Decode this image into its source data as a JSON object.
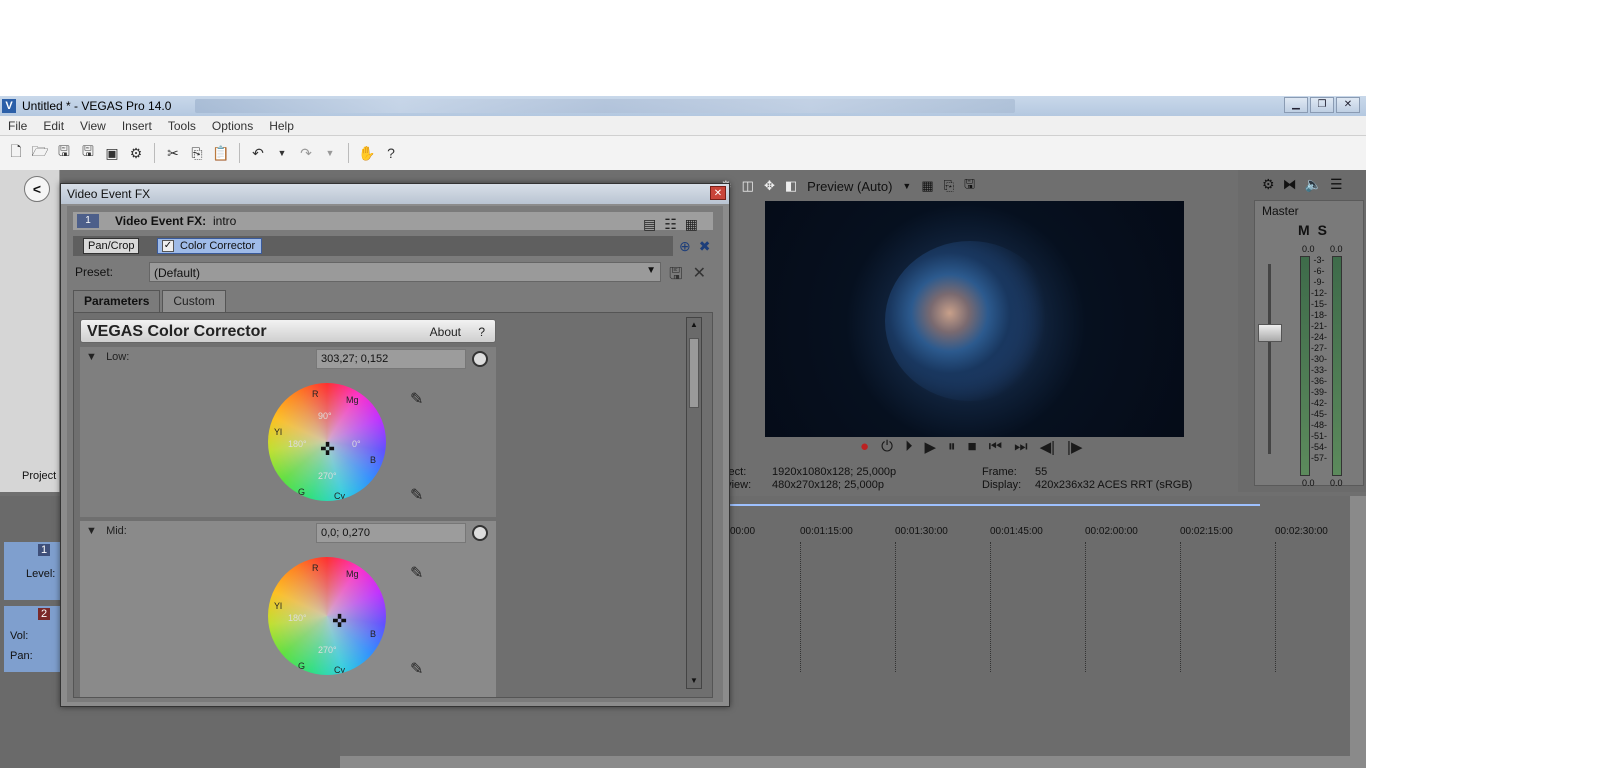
{
  "window": {
    "title": "Untitled * - VEGAS Pro 14.0",
    "btn_min": "▁",
    "btn_max": "❐",
    "btn_close": "✕"
  },
  "menu": [
    "File",
    "Edit",
    "View",
    "Insert",
    "Tools",
    "Options",
    "Help"
  ],
  "toolbar_icons": [
    "new-icon",
    "open-icon",
    "save-icon",
    "save-as-icon",
    "render-icon",
    "properties-icon",
    "cut-icon",
    "copy-icon",
    "paste-icon",
    "undo-icon",
    "redo-icon",
    "hand-icon",
    "help-icon"
  ],
  "preview": {
    "quality": "Preview (Auto)",
    "project_label": "oject:",
    "project_value": "1920x1080x128; 25,000p",
    "preview_label": "eview:",
    "preview_value": "480x270x128; 25,000p",
    "frame_label": "Frame:",
    "frame_value": "55",
    "display_label": "Display:",
    "display_value": "420x236x32 ACES RRT (sRGB)"
  },
  "master": {
    "label": "Master",
    "m": "M",
    "s": "S",
    "peak_left": "0.0",
    "peak_right": "0.0",
    "bottom_left": "0.0",
    "bottom_right": "0.0",
    "scale": [
      "3",
      "6",
      "9",
      "12",
      "15",
      "18",
      "21",
      "24",
      "27",
      "30",
      "33",
      "36",
      "39",
      "42",
      "45",
      "48",
      "51",
      "54",
      "57"
    ]
  },
  "timeline": {
    "ruler": [
      "00:00",
      "00:01:15:00",
      "00:01:30:00",
      "00:01:45:00",
      "00:02:00:00",
      "00:02:15:00",
      "00:02:30:00"
    ],
    "track1_num": "1",
    "track1_level": "Level:",
    "track2_num": "2",
    "track2_vol": "Vol:",
    "track2_pan": "Pan:",
    "project_tab": "Project"
  },
  "fx": {
    "title": "Video Event FX",
    "chain_num": "1",
    "chain_label": "Video Event FX:",
    "chain_name": "intro",
    "plugin1": "Pan/Crop",
    "plugin2": "Color Corrector",
    "preset_label": "Preset:",
    "preset_value": "(Default)",
    "tab_params": "Parameters",
    "tab_custom": "Custom",
    "cc_title": "VEGAS Color Corrector",
    "about": "About",
    "q": "?",
    "low_label": "Low:",
    "low_value": "303,27; 0,152",
    "mid_label": "Mid:",
    "mid_value": "0,0; 0,270",
    "wheel": {
      "r": "R",
      "mg": "Mg",
      "yl": "Yl",
      "b": "B",
      "g": "G",
      "cy": "Cy",
      "d90": "90°",
      "d180": "180°",
      "d0": "0°",
      "d270": "270°"
    }
  }
}
